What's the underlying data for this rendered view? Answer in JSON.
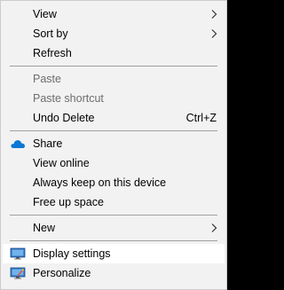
{
  "context_menu": {
    "view": {
      "label": "View",
      "icon": "chevron-right-icon"
    },
    "sort_by": {
      "label": "Sort by",
      "icon": "chevron-right-icon"
    },
    "refresh": {
      "label": "Refresh"
    },
    "paste": {
      "label": "Paste",
      "enabled": false
    },
    "paste_shortcut": {
      "label": "Paste shortcut",
      "enabled": false
    },
    "undo_delete": {
      "label": "Undo Delete",
      "shortcut": "Ctrl+Z"
    },
    "share": {
      "label": "Share",
      "icon": "onedrive-cloud-icon"
    },
    "view_online": {
      "label": "View online"
    },
    "always_keep": {
      "label": "Always keep on this device"
    },
    "free_up_space": {
      "label": "Free up space"
    },
    "new": {
      "label": "New",
      "icon": "chevron-right-icon"
    },
    "display_settings": {
      "label": "Display settings",
      "icon": "display-icon",
      "highlighted": true
    },
    "personalize": {
      "label": "Personalize",
      "icon": "personalize-icon"
    }
  },
  "colors": {
    "menu_background": "#f2f2f2",
    "hover_background": "#ffffff",
    "disabled_text": "#6d6d6d",
    "separator": "#a0a0a0",
    "onedrive_blue": "#0a78d4"
  }
}
